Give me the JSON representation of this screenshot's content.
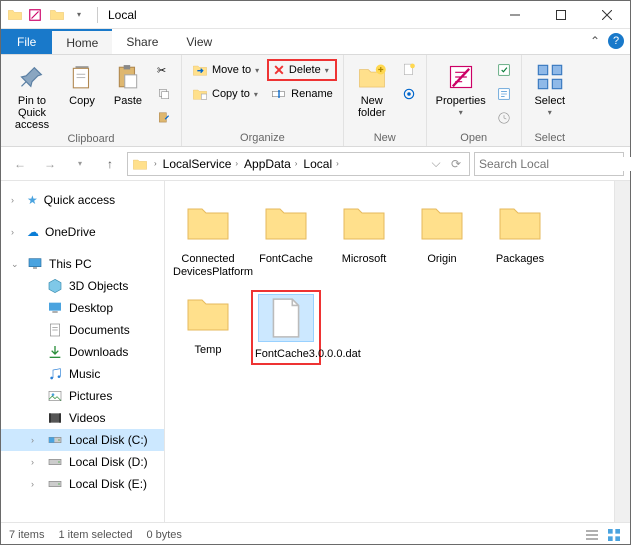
{
  "window": {
    "title": "Local"
  },
  "menu": {
    "file": "File",
    "tabs": [
      "Home",
      "Share",
      "View"
    ],
    "activeTab": "Home"
  },
  "ribbon": {
    "clipboard": {
      "label": "Clipboard",
      "pin": "Pin to Quick access",
      "copy": "Copy",
      "paste": "Paste"
    },
    "organize": {
      "label": "Organize",
      "moveTo": "Move to",
      "copyTo": "Copy to",
      "delete": "Delete",
      "rename": "Rename"
    },
    "new": {
      "label": "New",
      "newFolder": "New folder"
    },
    "open": {
      "label": "Open",
      "properties": "Properties"
    },
    "select": {
      "label": "Select",
      "select": "Select"
    }
  },
  "address": {
    "crumbs": [
      "LocalService",
      "AppData",
      "Local"
    ],
    "searchPlaceholder": "Search Local"
  },
  "nav": {
    "quickAccess": "Quick access",
    "oneDrive": "OneDrive",
    "thisPC": "This PC",
    "children": [
      "3D Objects",
      "Desktop",
      "Documents",
      "Downloads",
      "Music",
      "Pictures",
      "Videos",
      "Local Disk (C:)",
      "Local Disk (D:)",
      "Local Disk (E:)"
    ],
    "selected": "Local Disk (C:)"
  },
  "content": {
    "items": [
      {
        "name": "Connected DevicesPlatform",
        "type": "folder"
      },
      {
        "name": "FontCache",
        "type": "folder"
      },
      {
        "name": "Microsoft",
        "type": "folder"
      },
      {
        "name": "Origin",
        "type": "folder"
      },
      {
        "name": "Packages",
        "type": "folder"
      },
      {
        "name": "Temp",
        "type": "folder"
      },
      {
        "name": "FontCache3.0.0.0.dat",
        "type": "file",
        "selected": true,
        "highlighted": true
      }
    ]
  },
  "status": {
    "count": "7 items",
    "selection": "1 item selected",
    "size": "0 bytes"
  }
}
